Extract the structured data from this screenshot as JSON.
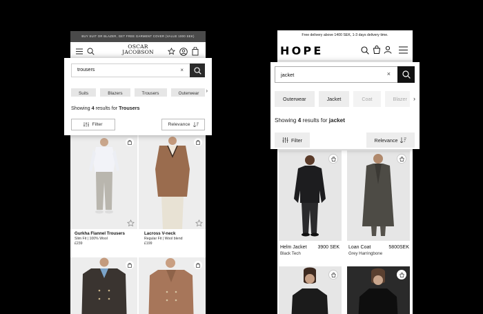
{
  "left": {
    "promo": "BUY SUIT OR BLAZER, GET FREE GARMENT COVER (VALUE 1000 SEK)",
    "logo_line1": "OSCAR",
    "logo_line2": "JACOBSON",
    "search": {
      "value": "trousers",
      "clear": "×"
    },
    "chips": [
      "Suits",
      "Blazers",
      "Trousers",
      "Outerwear"
    ],
    "results_prefix": "Showing ",
    "results_count": "4",
    "results_mid": " results for ",
    "results_term": "Trousers",
    "filter_label": "Filter",
    "relevance_label": "Relevance",
    "products": [
      {
        "name": "Gurkha Flannel Trousers",
        "detail": "Slim Fit | 100% Wool",
        "price": "£239"
      },
      {
        "name": "Lacross V-neck",
        "detail": "Regular Fit | Wool blend",
        "price": "£199"
      }
    ],
    "colors": {
      "promo_bg": "#4a4a4a",
      "search_button": "#2b2b2b",
      "chip_bg": "#e6e6e6"
    }
  },
  "right": {
    "promo": "Free delivery above 1400 SEK, 1-3 days delivery time.",
    "logo": "HOPE",
    "search": {
      "value": "jacket",
      "clear": "×"
    },
    "chips": [
      {
        "label": "Outerwear",
        "faded": false
      },
      {
        "label": "Jacket",
        "faded": false
      },
      {
        "label": "Coat",
        "faded": true
      },
      {
        "label": "Blazer",
        "faded": true
      }
    ],
    "results_prefix": "Showing ",
    "results_count": "4",
    "results_mid": " results for ",
    "results_term": "jacket",
    "filter_label": "Filter",
    "relevance_label": "Relevance",
    "products": [
      {
        "name": "Helm Jacket",
        "price": "3900 SEK",
        "detail": "Black Tech"
      },
      {
        "name": "Loan Coat",
        "price": "5800SEK",
        "detail": "Grey Harringbone"
      }
    ],
    "colors": {
      "search_button": "#111111",
      "chip_bg": "#ededed"
    }
  },
  "icons": {
    "menu": "menu-icon",
    "search": "search-icon",
    "wishlist": "star-icon",
    "account": "user-icon",
    "bag": "bag-icon",
    "clear": "close-icon",
    "chevron": "chevron-right-icon",
    "filter": "sliders-icon",
    "sort": "sort-icon"
  }
}
